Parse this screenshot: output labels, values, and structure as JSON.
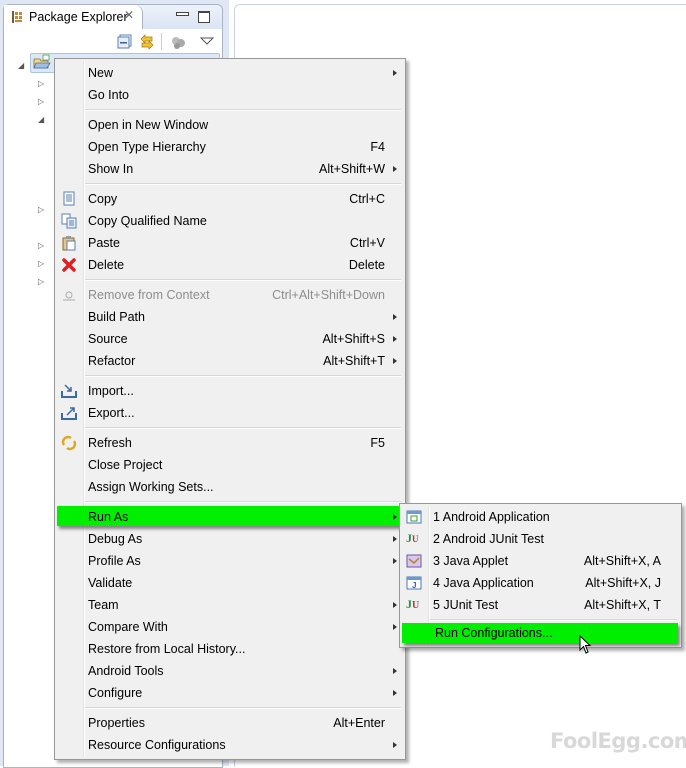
{
  "panel": {
    "title": "Package Explorer",
    "icons": [
      "package-explorer-icon",
      "close-icon",
      "minimize-icon",
      "maximize-icon",
      "collapse-all-icon",
      "link-with-editor-icon",
      "focus-icon",
      "view-menu-icon"
    ]
  },
  "context_menu": {
    "items": [
      {
        "label": "New",
        "shortcut": "",
        "submenu": true
      },
      {
        "label": "Go Into",
        "shortcut": "",
        "submenu": false
      },
      {
        "label": "Open in New Window",
        "shortcut": "",
        "submenu": false
      },
      {
        "label": "Open Type Hierarchy",
        "shortcut": "F4",
        "submenu": false
      },
      {
        "label": "Show In",
        "shortcut": "Alt+Shift+W",
        "submenu": true
      },
      {
        "label": "Copy",
        "shortcut": "Ctrl+C",
        "icon": "copy-icon"
      },
      {
        "label": "Copy Qualified Name",
        "shortcut": "",
        "icon": "copy-qualified-name-icon"
      },
      {
        "label": "Paste",
        "shortcut": "Ctrl+V",
        "icon": "paste-icon"
      },
      {
        "label": "Delete",
        "shortcut": "Delete",
        "icon": "delete-icon"
      },
      {
        "label": "Remove from Context",
        "shortcut": "Ctrl+Alt+Shift+Down",
        "disabled": true,
        "icon": "remove-context-icon"
      },
      {
        "label": "Build Path",
        "shortcut": "",
        "submenu": true
      },
      {
        "label": "Source",
        "shortcut": "Alt+Shift+S",
        "submenu": true
      },
      {
        "label": "Refactor",
        "shortcut": "Alt+Shift+T",
        "submenu": true
      },
      {
        "label": "Import...",
        "shortcut": "",
        "icon": "import-icon"
      },
      {
        "label": "Export...",
        "shortcut": "",
        "icon": "export-icon"
      },
      {
        "label": "Refresh",
        "shortcut": "F5",
        "icon": "refresh-icon"
      },
      {
        "label": "Close Project",
        "shortcut": ""
      },
      {
        "label": "Assign Working Sets...",
        "shortcut": ""
      },
      {
        "label": "Run As",
        "shortcut": "",
        "submenu": true,
        "highlighted": true
      },
      {
        "label": "Debug As",
        "shortcut": "",
        "submenu": true
      },
      {
        "label": "Profile As",
        "shortcut": "",
        "submenu": true
      },
      {
        "label": "Validate",
        "shortcut": ""
      },
      {
        "label": "Team",
        "shortcut": "",
        "submenu": true
      },
      {
        "label": "Compare With",
        "shortcut": "",
        "submenu": true
      },
      {
        "label": "Restore from Local History...",
        "shortcut": ""
      },
      {
        "label": "Android Tools",
        "shortcut": "",
        "submenu": true
      },
      {
        "label": "Configure",
        "shortcut": "",
        "submenu": true
      },
      {
        "label": "Properties",
        "shortcut": "Alt+Enter"
      },
      {
        "label": "Resource Configurations",
        "shortcut": "",
        "submenu": true
      }
    ]
  },
  "run_as_submenu": {
    "items": [
      {
        "label": "1 Android Application",
        "shortcut": "",
        "icon": "android-application-icon"
      },
      {
        "label": "2 Android JUnit Test",
        "shortcut": "",
        "icon": "android-junit-icon"
      },
      {
        "label": "3 Java Applet",
        "shortcut": "Alt+Shift+X, A",
        "icon": "java-applet-icon"
      },
      {
        "label": "4 Java Application",
        "shortcut": "Alt+Shift+X, J",
        "icon": "java-application-icon"
      },
      {
        "label": "5 JUnit Test",
        "shortcut": "Alt+Shift+X, T",
        "icon": "junit-icon"
      },
      {
        "label": "Run Configurations...",
        "shortcut": "",
        "highlighted": true
      }
    ]
  },
  "watermark": "FoolEgg.com",
  "colors": {
    "highlight": "#00ee00",
    "menu_bg": "#f0f0f0",
    "disabled_text": "#8d8d8d"
  }
}
